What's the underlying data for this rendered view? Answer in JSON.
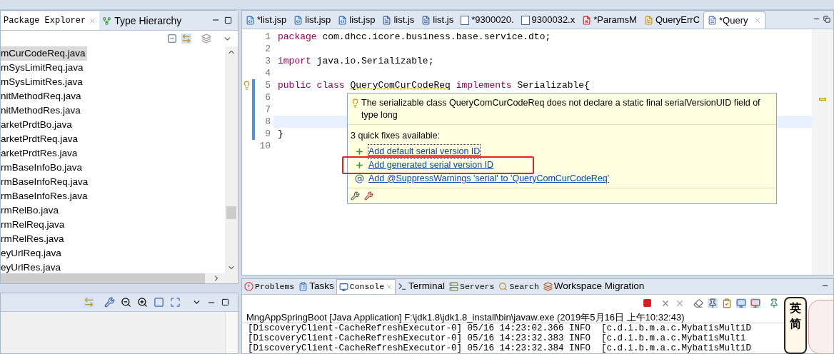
{
  "left_panel": {
    "tabs": [
      {
        "label": "Package Explorer",
        "selected": true
      },
      {
        "label": "Type Hierarchy",
        "kind": "hierarchy",
        "selected": false
      }
    ],
    "files": [
      {
        "name": "mCurCodeReq.java",
        "selected": true
      },
      {
        "name": "mSysLimitReq.java",
        "selected": false
      },
      {
        "name": "mSysLimitRes.java",
        "selected": false
      },
      {
        "name": "nitMethodReq.java",
        "selected": false
      },
      {
        "name": "nitMethodRes.java",
        "selected": false
      },
      {
        "name": "arketPrdtBo.java",
        "selected": false
      },
      {
        "name": "arketPrdtReq.java",
        "selected": false
      },
      {
        "name": "arketPrdtRes.java",
        "selected": false
      },
      {
        "name": "rmBaseInfoBo.java",
        "selected": false
      },
      {
        "name": "rmBaseInfoReq.java",
        "selected": false
      },
      {
        "name": "rmBaseInfoRes.java",
        "selected": false
      },
      {
        "name": "rmRelBo.java",
        "selected": false
      },
      {
        "name": "rmRelReq.java",
        "selected": false
      },
      {
        "name": "rmRelRes.java",
        "selected": false
      },
      {
        "name": "eyUrlReq.java",
        "selected": false
      },
      {
        "name": "eyUrlRes.java",
        "selected": false
      }
    ]
  },
  "editor": {
    "tabs": [
      {
        "label": "*list.jsp",
        "kind": "jsp",
        "selected": false
      },
      {
        "label": "list.jsp",
        "kind": "jsp",
        "selected": false
      },
      {
        "label": "list.jsp",
        "kind": "jsp",
        "selected": false
      },
      {
        "label": "list.js",
        "kind": "js",
        "selected": false
      },
      {
        "label": "list.js",
        "kind": "js",
        "selected": false
      },
      {
        "label": "*9300020.",
        "kind": "xml",
        "selected": false
      },
      {
        "label": "9300032.x",
        "kind": "xml",
        "selected": false
      },
      {
        "label": "*ParamsM",
        "kind": "java-error",
        "selected": false
      },
      {
        "label": "QueryErrC",
        "kind": "java-warning",
        "selected": false
      },
      {
        "label": "*Query",
        "kind": "java",
        "selected": true
      }
    ],
    "lines": [
      {
        "number": "1",
        "tokens": [
          {
            "text": "package",
            "kind": "keyword"
          },
          {
            "text": "com.dhcc.icore.business.base.service.dto;",
            "kind": "plain"
          }
        ]
      },
      {
        "number": "2"
      },
      {
        "number": "3",
        "tokens": [
          {
            "text": "import",
            "kind": "keyword"
          },
          {
            "text": "java.io.Serializable;",
            "kind": "plain"
          }
        ]
      },
      {
        "number": "4"
      },
      {
        "number": "5",
        "warning": true,
        "tokens": [
          {
            "text": "public class",
            "kind": "keyword"
          },
          {
            "text": "QueryComCurCodeReq",
            "kind": "flagged"
          },
          {
            "text": "implements",
            "kind": "keyword"
          },
          {
            "text": "Serializable{",
            "kind": "plain"
          }
        ]
      },
      {
        "number": "6"
      },
      {
        "number": "7"
      },
      {
        "number": "8",
        "current": true
      },
      {
        "number": "9",
        "tokens": [
          {
            "text": "}",
            "kind": "plain"
          }
        ]
      },
      {
        "number": "10"
      }
    ]
  },
  "quick_fix": {
    "message": "The serializable class QueryComCurCodeReq does not declare a static final serialVersionUID field of type long",
    "summary": "3 quick fixes available:",
    "fixes": [
      {
        "label": "Add default serial version ID",
        "kind": "add",
        "focused": true,
        "highlighted": false
      },
      {
        "label": "Add generated serial version ID",
        "kind": "add",
        "focused": false,
        "highlighted": true
      },
      {
        "label": "Add @SuppressWarnings 'serial' to 'QueryComCurCodeReq'",
        "kind": "annotation",
        "focused": false,
        "highlighted": false
      }
    ]
  },
  "bottom_panel": {
    "tabs": [
      {
        "label": "Problems",
        "kind": "problems",
        "mono": true,
        "selected": false
      },
      {
        "label": "Tasks",
        "kind": "tasks",
        "mono": false,
        "selected": false
      },
      {
        "label": "Console",
        "kind": "console",
        "mono": true,
        "selected": true
      },
      {
        "label": "Terminal",
        "kind": "terminal",
        "mono": false,
        "selected": false
      },
      {
        "label": "Servers",
        "kind": "servers",
        "mono": true,
        "selected": false
      },
      {
        "label": "Search",
        "kind": "search",
        "mono": true,
        "selected": false
      },
      {
        "label": "Workspace Migration",
        "kind": "migration",
        "mono": false,
        "selected": false
      }
    ],
    "console_header": "MngAppSpringBoot [Java Application] F:\\jdk1.8\\jdk1.8_install\\bin\\javaw.exe (2019年5月16日 上午10:32:43)",
    "console_lines": [
      "[DiscoveryClient-CacheRefreshExecutor-0] 05/16 14:23:02.366 INFO  [c.d.i.b.m.a.c.MybatisMultiD",
      "[DiscoveryClient-CacheRefreshExecutor-0] 05/16 14:23:32.383 INFO  [c.d.i.b.m.a.c.MybatisMulti",
      "[DiscoveryClient-CacheRefreshExecutor-0] 05/16 14:23:32.384 INFO  [c.d.i.b.m.a.c.MybatisMultiD"
    ]
  },
  "ime": {
    "labels": [
      "英",
      "简"
    ]
  }
}
